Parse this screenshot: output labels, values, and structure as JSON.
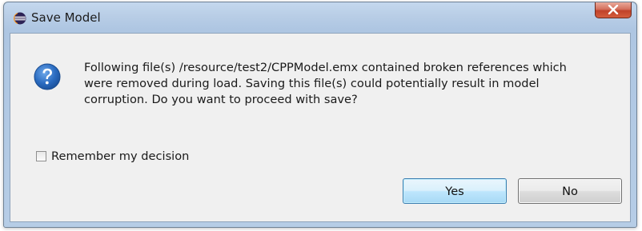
{
  "dialog": {
    "title": "Save Model",
    "message": "Following file(s) /resource/test2/CPPModel.emx contained broken references which\nwere removed during load. Saving this file(s) could potentially result in model\ncorruption. Do you want to proceed with save?",
    "remember_label": "Remember my decision",
    "remember_checked": false,
    "yes_label": "Yes",
    "no_label": "No"
  },
  "icons": {
    "app": "eclipse-icon",
    "close": "close-icon",
    "question": "question-icon"
  },
  "colors": {
    "close_button": "#c9523a",
    "question_icon": "#2a6bc0",
    "default_button_border": "#3c7fb1"
  }
}
